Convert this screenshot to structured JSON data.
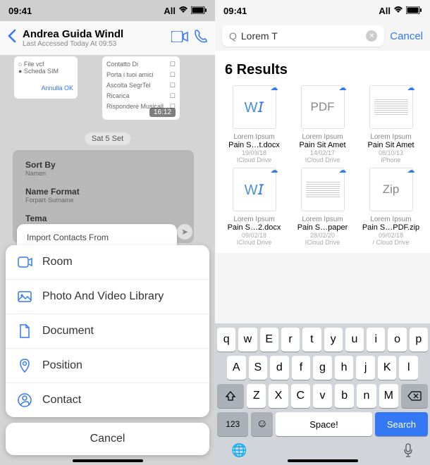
{
  "status": {
    "time": "09:41",
    "carrier": "All"
  },
  "left": {
    "header": {
      "name": "Andrea Guida Windl",
      "sub": "Last Accessed Today At 09:53"
    },
    "card1": {
      "l1": "○ File vcf",
      "l2": "● Scheda SIM",
      "l3": "Annulla   OK"
    },
    "card2": {
      "r1": "Contatto Di",
      "r2": "Porta i tuoi amici",
      "r3": "Ascolta SegrTel",
      "r4": "Ricarica",
      "r5": "Rispondere Musicall"
    },
    "time_badge": "16:12",
    "date_pill": "Sat 5 Set",
    "form": {
      "l1": "Sort By",
      "v1": "Namen",
      "l2": "Name Format",
      "v2": "Forpart·Surname",
      "l3": "Tema"
    },
    "import_title": "Import Contacts From",
    "sheet": {
      "room": "Room",
      "photo": "Photo And Video Library",
      "document": "Document",
      "position": "Position",
      "contact": "Contact",
      "cancel": "Cancel"
    }
  },
  "right": {
    "search_text": "Lorem T",
    "cancel": "Cancel",
    "results_title": "6 Results",
    "items": [
      {
        "thumb": "W",
        "name1": "Lorem Ipsum",
        "name2": "Pain S…t.docx",
        "date": "19/09/18",
        "loc": "ICloud Drive"
      },
      {
        "thumb": "PDF",
        "name1": "Lorem Ipsum",
        "name2": "Pain Sit Amet",
        "date": "14/02/17",
        "loc": "ICloud Drive"
      },
      {
        "thumb": "lines",
        "name1": "Lorem Ipsum",
        "name2": "Pain Sit Amet",
        "date": "08/10/13",
        "loc": "iPhone"
      },
      {
        "thumb": "W",
        "name1": "Lorem Ipsum",
        "name2": "Pain S…2.docx",
        "date": "09/02/18",
        "loc": "ICloud Drive"
      },
      {
        "thumb": "lines",
        "name1": "Lorem Ipsum",
        "name2": "Pain S…paper",
        "date": "28/02/20",
        "loc": "ICloud Drive"
      },
      {
        "thumb": "Zip",
        "name1": "Lorem Ipsum",
        "name2": "Pain S…PDF.zip",
        "date": "09/02/18",
        "loc": "/ Cloud Drive"
      }
    ],
    "keyboard": {
      "row1": [
        "q",
        "w",
        "E",
        "r",
        "t",
        "y",
        "u",
        "i",
        "o",
        "p"
      ],
      "row2": [
        "A",
        "S",
        "d",
        "f",
        "g",
        "h",
        "j",
        "K",
        "l"
      ],
      "row3": [
        "Z",
        "X",
        "C",
        "v",
        "b",
        "n",
        "M"
      ],
      "space": "Space!",
      "search": "Search",
      "num": "123"
    }
  }
}
